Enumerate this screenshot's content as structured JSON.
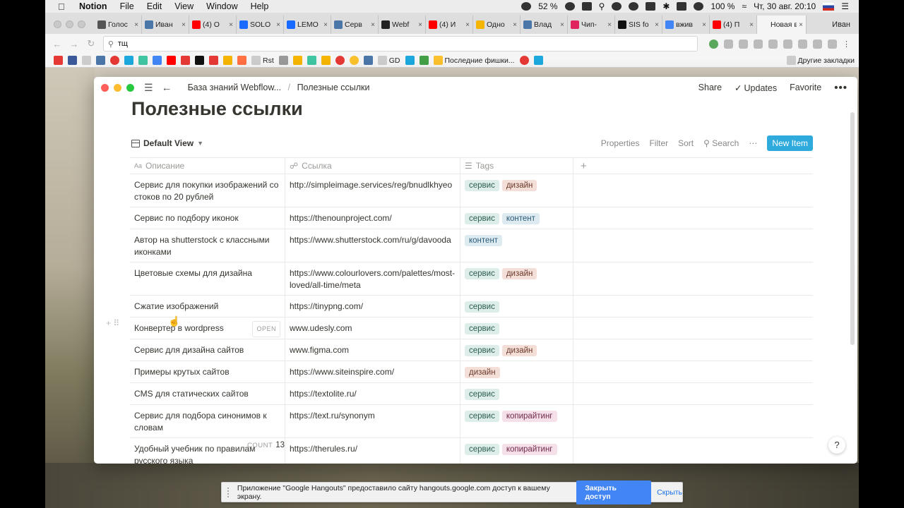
{
  "menubar": {
    "app_name": "Notion",
    "menus": [
      "File",
      "Edit",
      "View",
      "Window",
      "Help"
    ],
    "battery": "52 %",
    "wifi_level": "100 %",
    "datetime": "Чт, 30 авг. 20:10"
  },
  "browser": {
    "tabs": [
      {
        "title": "Голос",
        "color": "#555"
      },
      {
        "title": "Иван",
        "color": "#4a76a8"
      },
      {
        "title": "(4) О",
        "color": "#ff0000"
      },
      {
        "title": "SOLO",
        "color": "#1769ff"
      },
      {
        "title": "LEMO",
        "color": "#1769ff"
      },
      {
        "title": "Серв",
        "color": "#4a76a8"
      },
      {
        "title": "Webf",
        "color": "#222"
      },
      {
        "title": "(4) И",
        "color": "#ff0000"
      },
      {
        "title": "Одно",
        "color": "#f4b400"
      },
      {
        "title": "Влад",
        "color": "#4a76a8"
      },
      {
        "title": "Чип-",
        "color": "#e0245e"
      },
      {
        "title": "SIS fo",
        "color": "#111"
      },
      {
        "title": "вжив",
        "color": "#4285f4"
      },
      {
        "title": "(4) П",
        "color": "#ff0000"
      },
      {
        "title": "Новая вк",
        "color": "#f5f5f5"
      }
    ],
    "user": "Иван",
    "address": "тщ",
    "bookmarks": [
      "Rst",
      "GD",
      "Последние фишки..."
    ],
    "other_bookmarks": "Другие закладки"
  },
  "notion": {
    "breadcrumb_parent": "База знаний Webflow...",
    "breadcrumb_current": "Полезные ссылки",
    "share": "Share",
    "updates": "Updates",
    "favorite": "Favorite",
    "page_title": "Полезные ссылки",
    "view_name": "Default View",
    "properties": "Properties",
    "filter": "Filter",
    "sort": "Sort",
    "search": "Search",
    "new_item": "New Item",
    "columns": {
      "description": "Описание",
      "link": "Ссылка",
      "tags": "Tags"
    },
    "open_label": "OPEN",
    "count_label": "COUNT",
    "count_value": "13",
    "help": "?",
    "tag_colors": {
      "сервис": {
        "bg": "#ddedea",
        "fg": "#2d5c50"
      },
      "дизайн": {
        "bg": "#f4dfd8",
        "fg": "#6b3a2a"
      },
      "контент": {
        "bg": "#ddebf1",
        "fg": "#2a5a77"
      },
      "копирайтинг": {
        "bg": "#f5e0e9",
        "fg": "#6e2a4a"
      }
    },
    "rows": [
      {
        "desc": "Сервис для покупки изображений со стоков по 20 рублей",
        "link": "http://simpleimage.services/reg/bnudlkhyeo",
        "tags": [
          "сервис",
          "дизайн"
        ]
      },
      {
        "desc": "Сервис по подбору иконок",
        "link": "https://thenounproject.com/",
        "tags": [
          "сервис",
          "контент"
        ]
      },
      {
        "desc": "Автор на shutterstock с классными иконками",
        "link": "https://www.shutterstock.com/ru/g/davooda",
        "tags": [
          "контент"
        ]
      },
      {
        "desc": "Цветовые схемы для дизайна",
        "link": "https://www.colourlovers.com/palettes/most-loved/all-time/meta",
        "tags": [
          "сервис",
          "дизайн"
        ]
      },
      {
        "desc": "Сжатие изображений",
        "link": "https://tinypng.com/",
        "tags": [
          "сервис"
        ]
      },
      {
        "desc": "Конвертер в wordpress",
        "link": "www.udesly.com",
        "tags": [
          "сервис"
        ],
        "hovered": true
      },
      {
        "desc": "Сервис для дизайна сайтов",
        "link": "www.figma.com",
        "tags": [
          "сервис",
          "дизайн"
        ]
      },
      {
        "desc": "Примеры крутых сайтов",
        "link": "https://www.siteinspire.com/",
        "tags": [
          "дизайн"
        ]
      },
      {
        "desc": "CMS для статических сайтов",
        "link": "https://textolite.ru/",
        "tags": [
          "сервис"
        ]
      },
      {
        "desc": "Сервис для подбора синонимов к словам",
        "link": "https://text.ru/synonym",
        "tags": [
          "сервис",
          "копирайтинг"
        ]
      },
      {
        "desc": "Удобный учебник по правилам русского языка",
        "link": "https://therules.ru/",
        "tags": [
          "сервис",
          "копирайтинг"
        ]
      }
    ]
  },
  "hangouts": {
    "message": "Приложение \"Google Hangouts\" предоставило сайту hangouts.google.com доступ к вашему экрану.",
    "stop_button": "Закрыть доступ",
    "hide_button": "Скрыть"
  }
}
